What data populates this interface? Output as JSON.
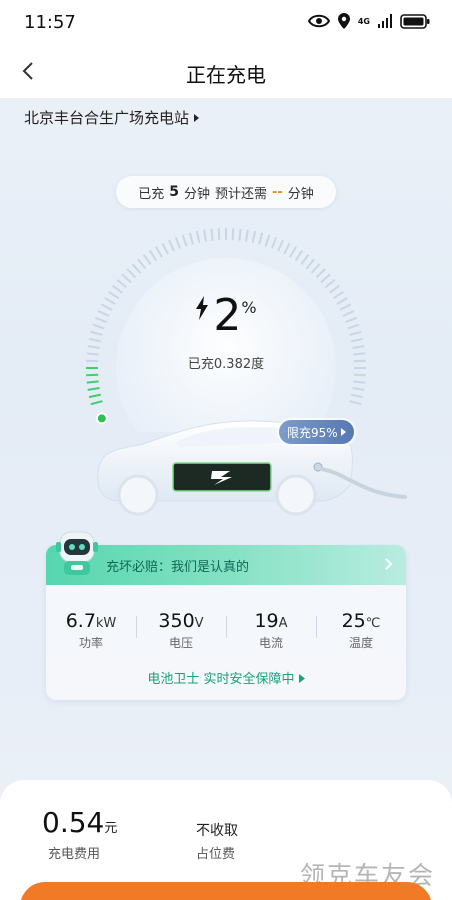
{
  "status_bar": {
    "time": "11:57",
    "network": "4G"
  },
  "nav": {
    "title": "正在充电"
  },
  "station": {
    "name": "北京丰台合生广场充电站"
  },
  "charge_time": {
    "prefix": "已充",
    "elapsed": "5",
    "unit1": "分钟",
    "mid": "预计还需",
    "remaining": "--",
    "unit2": "分钟"
  },
  "progress": {
    "percent": "2",
    "percent_sign": "%",
    "energy": "已充0.382度",
    "fraction": 0.02
  },
  "limit": {
    "label": "限充95%"
  },
  "card": {
    "banner": "充坏必赔：我们是认真的",
    "stats": [
      {
        "value": "6.7",
        "unit": "kW",
        "label": "功率"
      },
      {
        "value": "350",
        "unit": "V",
        "label": "电压"
      },
      {
        "value": "19",
        "unit": "A",
        "label": "电流"
      },
      {
        "value": "25",
        "unit": "℃",
        "label": "温度"
      }
    ],
    "guard": "电池卫士 实时安全保障中"
  },
  "fees": {
    "amount": "0.54",
    "currency": "元",
    "amount_label": "充电费用",
    "occupancy": "不收取",
    "occupancy_label": "占位费"
  },
  "watermark": "领克车友会",
  "colors": {
    "accent_green": "#1aa07e",
    "button_orange": "#f07a26",
    "limit_blue": "#5678b2"
  }
}
